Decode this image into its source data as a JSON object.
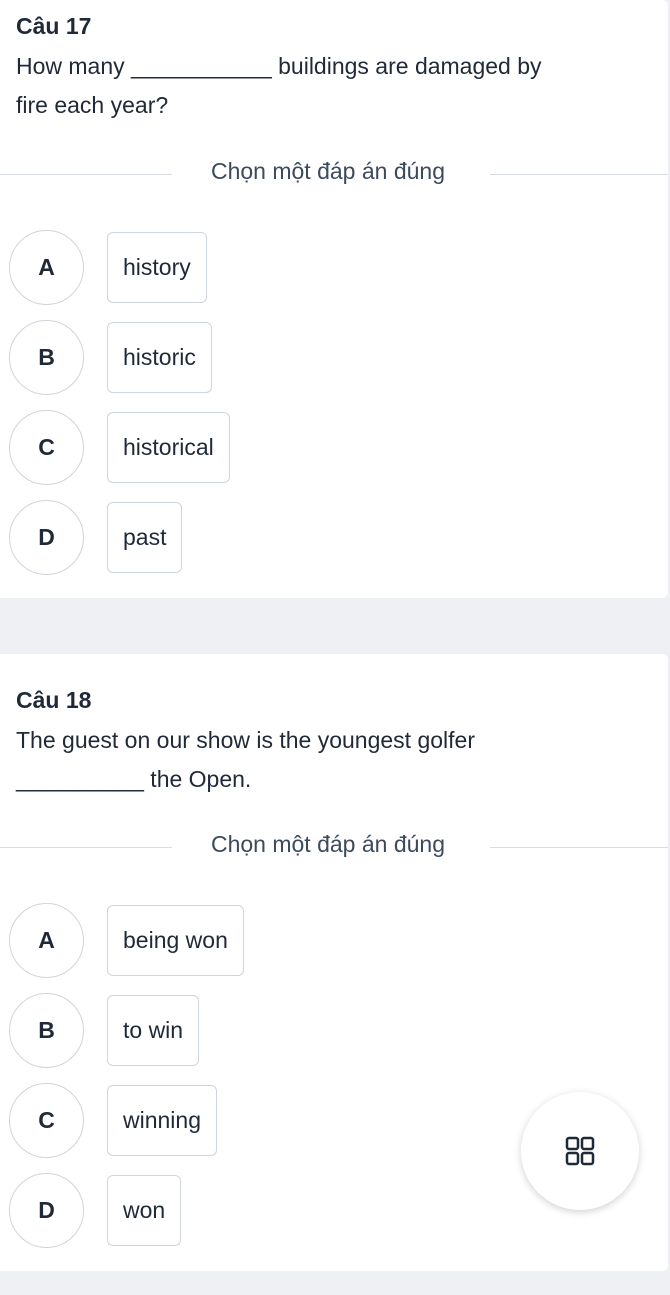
{
  "divider_label": "Chọn một đáp án đúng",
  "questions": [
    {
      "title": "Câu 17",
      "text_lines": [
        "How many ___________ buildings are damaged by",
        "fire each year?"
      ],
      "options": [
        {
          "letter": "A",
          "text": "history"
        },
        {
          "letter": "B",
          "text": "historic"
        },
        {
          "letter": "C",
          "text": "historical"
        },
        {
          "letter": "D",
          "text": "past"
        }
      ]
    },
    {
      "title": "Câu 18",
      "text_lines": [
        "The guest on our show is the youngest golfer",
        "__________ the Open."
      ],
      "options": [
        {
          "letter": "A",
          "text": "being won"
        },
        {
          "letter": "B",
          "text": "to win"
        },
        {
          "letter": "C",
          "text": "winning"
        },
        {
          "letter": "D",
          "text": "won"
        }
      ]
    }
  ],
  "fab_icon": "grid-icon"
}
